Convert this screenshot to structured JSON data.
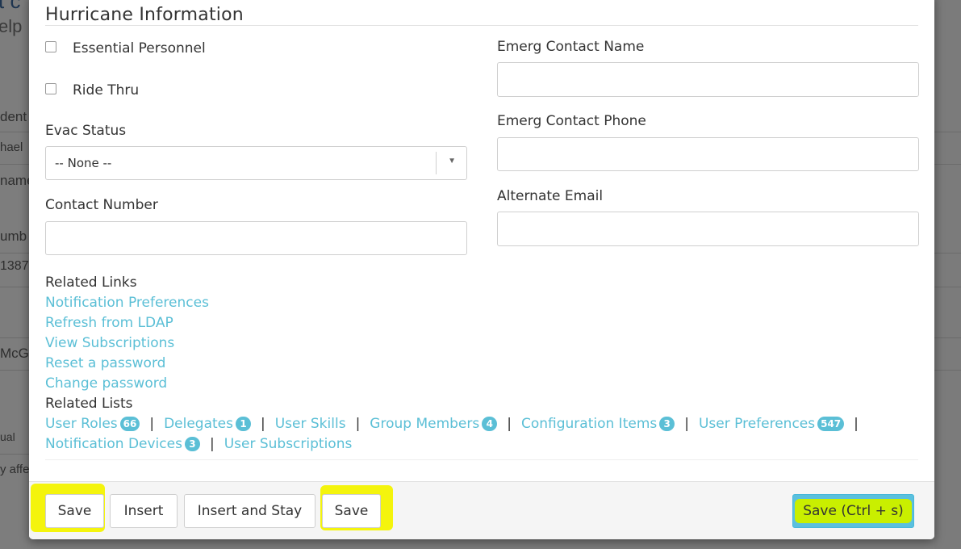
{
  "background": {
    "fragments": [
      "t c",
      "elp",
      "dent",
      "hael",
      "name",
      "umb",
      "1387",
      "McG",
      "ual",
      "y affe"
    ]
  },
  "modal": {
    "section_title": "Hurricane Information",
    "checkboxes": [
      {
        "label": "Essential Personnel",
        "checked": false
      },
      {
        "label": "Ride Thru",
        "checked": false
      }
    ],
    "evac_status": {
      "label": "Evac Status",
      "value": "-- None --"
    },
    "contact_number": {
      "label": "Contact Number",
      "value": ""
    },
    "emerg_contact_name": {
      "label": "Emerg Contact Name",
      "value": ""
    },
    "emerg_contact_phone": {
      "label": "Emerg Contact Phone",
      "value": ""
    },
    "alternate_email": {
      "label": "Alternate Email",
      "value": ""
    },
    "related_links": {
      "header": "Related Links",
      "items": [
        "Notification Preferences",
        "Refresh from LDAP",
        "View Subscriptions",
        "Reset a password",
        "Change password"
      ]
    },
    "related_lists": {
      "header": "Related Lists",
      "separator": "|",
      "items": [
        {
          "label": "User Roles",
          "count": "66"
        },
        {
          "label": "Delegates",
          "count": "1"
        },
        {
          "label": "User Skills",
          "count": ""
        },
        {
          "label": "Group Members",
          "count": "4"
        },
        {
          "label": "Configuration Items",
          "count": "3"
        },
        {
          "label": "User Preferences",
          "count": "547"
        },
        {
          "label": "Notification Devices",
          "count": "3"
        },
        {
          "label": "User Subscriptions",
          "count": ""
        }
      ]
    }
  },
  "footer": {
    "save_label": "Save",
    "insert_label": "Insert",
    "insert_stay_label": "Insert and Stay",
    "save2_label": "Save",
    "save_ctrl_label": "Save (Ctrl + s)"
  },
  "colors": {
    "link": "#5bbfd6",
    "highlight": "#f3f300",
    "primary_button": "#5bc0de"
  }
}
